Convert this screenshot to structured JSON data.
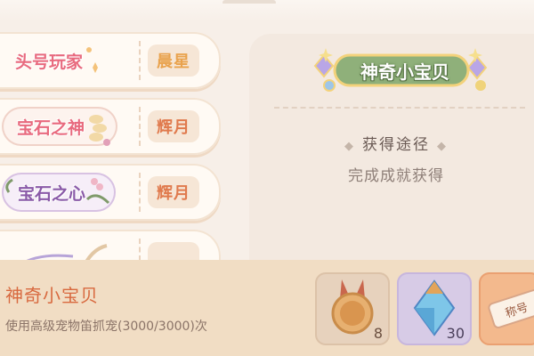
{
  "titles_list": [
    {
      "title": "头号玩家",
      "badge": "晨星",
      "badge_style": "gold",
      "title_style": "pink"
    },
    {
      "title": "宝石之神",
      "badge": "辉月",
      "badge_style": "red",
      "title_style": "pink"
    },
    {
      "title": "宝石之心",
      "badge": "辉月",
      "badge_style": "red",
      "title_style": "purple"
    }
  ],
  "detail": {
    "banner_title": "神奇小宝贝",
    "obtain_label": "获得途径",
    "obtain_method": "完成成就获得"
  },
  "bottom": {
    "item_name": "神奇小宝贝",
    "item_desc": "使用高级宠物笛抓宠(3000/3000)次",
    "rewards": [
      {
        "icon": "medal-icon",
        "count": "8"
      },
      {
        "icon": "crystal-icon",
        "count": "30"
      },
      {
        "icon": "title-tag-icon",
        "label": "称号"
      }
    ]
  },
  "colors": {
    "background": "#f7efe8",
    "accent_orange": "#d8693f",
    "badge_red": "#e07a4d",
    "badge_gold": "#e9a24d"
  }
}
